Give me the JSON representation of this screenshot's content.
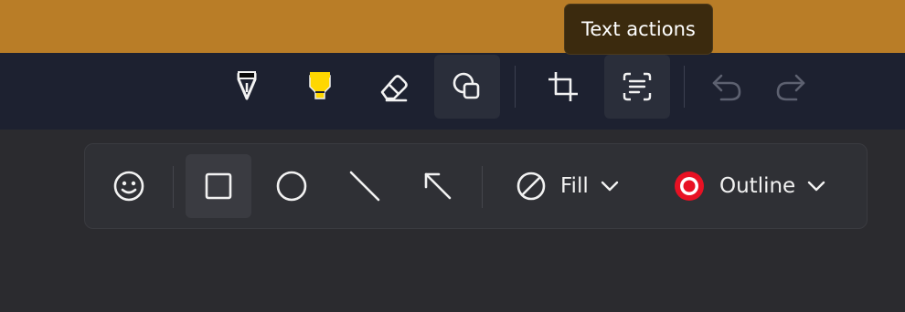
{
  "tooltip": {
    "text": "Text actions"
  },
  "toolbar": {
    "tools": [
      {
        "name": "ballpoint-pen",
        "icon": "pen-icon"
      },
      {
        "name": "highlighter",
        "icon": "highlighter-icon",
        "color": "#ffd700"
      },
      {
        "name": "eraser",
        "icon": "eraser-icon"
      },
      {
        "name": "shapes",
        "icon": "shapes-icon",
        "active": true
      },
      {
        "name": "crop",
        "icon": "crop-icon"
      },
      {
        "name": "text-actions",
        "icon": "text-actions-icon"
      },
      {
        "name": "undo",
        "icon": "undo-icon",
        "disabled": true
      },
      {
        "name": "redo",
        "icon": "redo-icon",
        "disabled": true
      }
    ]
  },
  "shape_panel": {
    "tools": [
      {
        "name": "emoji",
        "icon": "emoji-icon"
      },
      {
        "name": "rectangle",
        "icon": "rectangle-icon",
        "selected": true
      },
      {
        "name": "circle",
        "icon": "circle-icon"
      },
      {
        "name": "line",
        "icon": "line-icon"
      },
      {
        "name": "arrow",
        "icon": "arrow-icon"
      }
    ],
    "fill": {
      "label": "Fill",
      "icon": "no-fill-icon"
    },
    "outline": {
      "label": "Outline",
      "icon": "outline-color-icon",
      "color": "#e81123"
    }
  },
  "colors": {
    "titlebar_accent": "#b97d27",
    "toolbar_bg": "#1d2130",
    "canvas_bg": "#2b2b2f",
    "highlighter": "#ffd700",
    "outline": "#e81123"
  }
}
